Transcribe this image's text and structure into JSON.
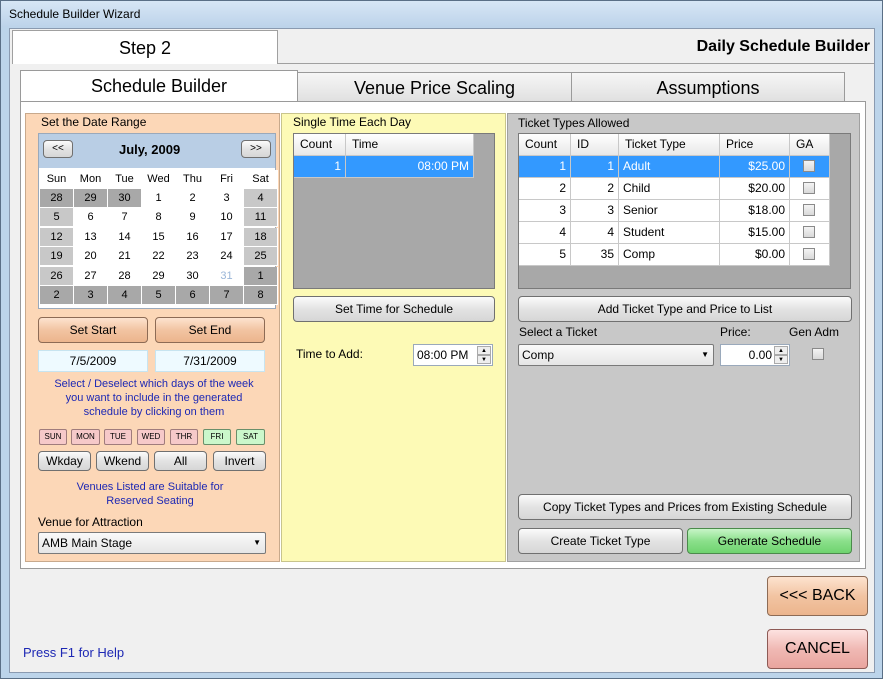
{
  "window": {
    "title": "Schedule Builder Wizard"
  },
  "header": {
    "step": "Step 2",
    "title": "Daily Schedule Builder"
  },
  "tabs": [
    {
      "label": "Schedule Builder",
      "active": true
    },
    {
      "label": "Venue Price Scaling",
      "active": false
    },
    {
      "label": "Assumptions",
      "active": false
    }
  ],
  "date_range": {
    "heading": "Set the Date Range",
    "month_label": "July, 2009",
    "prev_label": "<<",
    "next_label": ">>",
    "weekday_headers": [
      "Sun",
      "Mon",
      "Tue",
      "Wed",
      "Thu",
      "Fri",
      "Sat"
    ],
    "weeks": [
      [
        "28",
        "29",
        "30",
        "1",
        "2",
        "3",
        "4"
      ],
      [
        "5",
        "6",
        "7",
        "8",
        "9",
        "10",
        "11"
      ],
      [
        "12",
        "13",
        "14",
        "15",
        "16",
        "17",
        "18"
      ],
      [
        "19",
        "20",
        "21",
        "22",
        "23",
        "24",
        "25"
      ],
      [
        "26",
        "27",
        "28",
        "29",
        "30",
        "31",
        "1"
      ],
      [
        "2",
        "3",
        "4",
        "5",
        "6",
        "7",
        "8"
      ]
    ],
    "set_start_label": "Set Start",
    "set_end_label": "Set End",
    "start_date": "7/5/2009",
    "end_date": "7/31/2009",
    "instructions": "Select / Deselect which days of the week you want to include in the generated schedule by clicking on them",
    "day_toggles": [
      {
        "label": "SUN",
        "on": false
      },
      {
        "label": "MON",
        "on": false
      },
      {
        "label": "TUE",
        "on": false
      },
      {
        "label": "WED",
        "on": false
      },
      {
        "label": "THR",
        "on": false
      },
      {
        "label": "FRI",
        "on": true
      },
      {
        "label": "SAT",
        "on": true
      }
    ],
    "buttons": {
      "weekday": "Wkday",
      "weekend": "Wkend",
      "all": "All",
      "invert": "Invert"
    },
    "venue_note": "Venues Listed are Suitable for Reserved Seating",
    "venue_label": "Venue for Attraction",
    "venue_value": "AMB Main Stage"
  },
  "times": {
    "heading": "Single Time Each Day",
    "columns": [
      "Count",
      "Time"
    ],
    "rows": [
      {
        "count": "1",
        "time": "08:00 PM"
      }
    ],
    "set_time_label": "Set Time for Schedule",
    "time_to_add_label": "Time to Add:",
    "time_to_add_value": "08:00 PM"
  },
  "tickets": {
    "heading": "Ticket Types Allowed",
    "columns": [
      "Count",
      "ID",
      "Ticket Type",
      "Price",
      "GA"
    ],
    "rows": [
      {
        "count": "1",
        "id": "1",
        "type": "Adult",
        "price": "$25.00"
      },
      {
        "count": "2",
        "id": "2",
        "type": "Child",
        "price": "$20.00"
      },
      {
        "count": "3",
        "id": "3",
        "type": "Senior",
        "price": "$18.00"
      },
      {
        "count": "4",
        "id": "4",
        "type": "Student",
        "price": "$15.00"
      },
      {
        "count": "5",
        "id": "35",
        "type": "Comp",
        "price": "$0.00"
      }
    ],
    "add_label": "Add Ticket Type and Price to List",
    "select_label": "Select a Ticket",
    "select_value": "Comp",
    "price_label": "Price:",
    "price_value": "0.00",
    "gen_adm_label": "Gen Adm",
    "copy_label": "Copy Ticket Types and Prices from Existing Schedule",
    "create_label": "Create Ticket Type",
    "generate_label": "Generate Schedule"
  },
  "footer": {
    "help": "Press F1 for Help",
    "back": "<<< BACK",
    "cancel": "CANCEL"
  },
  "colors": {
    "left_panel": "#fcd7b7",
    "mid_panel": "#fdfab6",
    "right_panel": "#c8c8c8",
    "selection": "#3399ff"
  }
}
